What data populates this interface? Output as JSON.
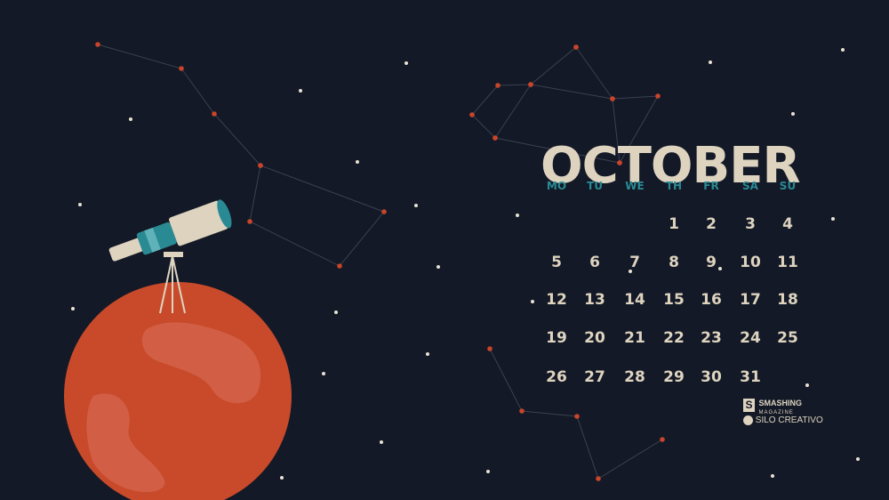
{
  "calendar": {
    "month": "OCTOBER",
    "weekdays": [
      "MO",
      "TU",
      "WE",
      "TH",
      "FR",
      "SA",
      "SU"
    ],
    "first_weekday_index": 3,
    "days": [
      "1",
      "2",
      "3",
      "4",
      "5",
      "6",
      "7",
      "8",
      "9",
      "10",
      "11",
      "12",
      "13",
      "14",
      "15",
      "16",
      "17",
      "18",
      "19",
      "20",
      "21",
      "22",
      "23",
      "24",
      "25",
      "26",
      "27",
      "28",
      "29",
      "30",
      "31"
    ]
  },
  "credits": {
    "smashing": "SMASHING",
    "magazine": "MAGAZINE",
    "silo": "SILO CREATIVO"
  },
  "colors": {
    "background": "#131926",
    "text": "#ddd3bf",
    "accent": "#2a8a94",
    "planet": "#c84a2a",
    "star_dot": "#c8452a"
  },
  "icons": [
    "telescope-illustration",
    "mars-planet-illustration",
    "constellation-lines",
    "smashing-logo-icon",
    "silo-creativo-logo-icon"
  ]
}
